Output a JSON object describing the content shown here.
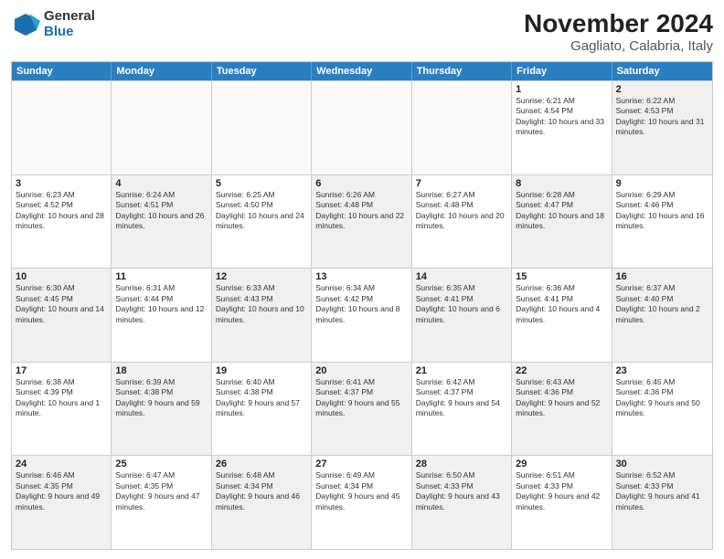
{
  "logo": {
    "general": "General",
    "blue": "Blue"
  },
  "title": "November 2024",
  "subtitle": "Gagliato, Calabria, Italy",
  "header_days": [
    "Sunday",
    "Monday",
    "Tuesday",
    "Wednesday",
    "Thursday",
    "Friday",
    "Saturday"
  ],
  "rows": [
    [
      {
        "day": "",
        "detail": "",
        "shaded": false,
        "empty": true
      },
      {
        "day": "",
        "detail": "",
        "shaded": false,
        "empty": true
      },
      {
        "day": "",
        "detail": "",
        "shaded": false,
        "empty": true
      },
      {
        "day": "",
        "detail": "",
        "shaded": false,
        "empty": true
      },
      {
        "day": "",
        "detail": "",
        "shaded": false,
        "empty": true
      },
      {
        "day": "1",
        "detail": "Sunrise: 6:21 AM\nSunset: 4:54 PM\nDaylight: 10 hours and 33 minutes.",
        "shaded": false,
        "empty": false
      },
      {
        "day": "2",
        "detail": "Sunrise: 6:22 AM\nSunset: 4:53 PM\nDaylight: 10 hours and 31 minutes.",
        "shaded": true,
        "empty": false
      }
    ],
    [
      {
        "day": "3",
        "detail": "Sunrise: 6:23 AM\nSunset: 4:52 PM\nDaylight: 10 hours and 28 minutes.",
        "shaded": false,
        "empty": false
      },
      {
        "day": "4",
        "detail": "Sunrise: 6:24 AM\nSunset: 4:51 PM\nDaylight: 10 hours and 26 minutes.",
        "shaded": true,
        "empty": false
      },
      {
        "day": "5",
        "detail": "Sunrise: 6:25 AM\nSunset: 4:50 PM\nDaylight: 10 hours and 24 minutes.",
        "shaded": false,
        "empty": false
      },
      {
        "day": "6",
        "detail": "Sunrise: 6:26 AM\nSunset: 4:48 PM\nDaylight: 10 hours and 22 minutes.",
        "shaded": true,
        "empty": false
      },
      {
        "day": "7",
        "detail": "Sunrise: 6:27 AM\nSunset: 4:48 PM\nDaylight: 10 hours and 20 minutes.",
        "shaded": false,
        "empty": false
      },
      {
        "day": "8",
        "detail": "Sunrise: 6:28 AM\nSunset: 4:47 PM\nDaylight: 10 hours and 18 minutes.",
        "shaded": true,
        "empty": false
      },
      {
        "day": "9",
        "detail": "Sunrise: 6:29 AM\nSunset: 4:46 PM\nDaylight: 10 hours and 16 minutes.",
        "shaded": false,
        "empty": false
      }
    ],
    [
      {
        "day": "10",
        "detail": "Sunrise: 6:30 AM\nSunset: 4:45 PM\nDaylight: 10 hours and 14 minutes.",
        "shaded": true,
        "empty": false
      },
      {
        "day": "11",
        "detail": "Sunrise: 6:31 AM\nSunset: 4:44 PM\nDaylight: 10 hours and 12 minutes.",
        "shaded": false,
        "empty": false
      },
      {
        "day": "12",
        "detail": "Sunrise: 6:33 AM\nSunset: 4:43 PM\nDaylight: 10 hours and 10 minutes.",
        "shaded": true,
        "empty": false
      },
      {
        "day": "13",
        "detail": "Sunrise: 6:34 AM\nSunset: 4:42 PM\nDaylight: 10 hours and 8 minutes.",
        "shaded": false,
        "empty": false
      },
      {
        "day": "14",
        "detail": "Sunrise: 6:35 AM\nSunset: 4:41 PM\nDaylight: 10 hours and 6 minutes.",
        "shaded": true,
        "empty": false
      },
      {
        "day": "15",
        "detail": "Sunrise: 6:36 AM\nSunset: 4:41 PM\nDaylight: 10 hours and 4 minutes.",
        "shaded": false,
        "empty": false
      },
      {
        "day": "16",
        "detail": "Sunrise: 6:37 AM\nSunset: 4:40 PM\nDaylight: 10 hours and 2 minutes.",
        "shaded": true,
        "empty": false
      }
    ],
    [
      {
        "day": "17",
        "detail": "Sunrise: 6:38 AM\nSunset: 4:39 PM\nDaylight: 10 hours and 1 minute.",
        "shaded": false,
        "empty": false
      },
      {
        "day": "18",
        "detail": "Sunrise: 6:39 AM\nSunset: 4:38 PM\nDaylight: 9 hours and 59 minutes.",
        "shaded": true,
        "empty": false
      },
      {
        "day": "19",
        "detail": "Sunrise: 6:40 AM\nSunset: 4:38 PM\nDaylight: 9 hours and 57 minutes.",
        "shaded": false,
        "empty": false
      },
      {
        "day": "20",
        "detail": "Sunrise: 6:41 AM\nSunset: 4:37 PM\nDaylight: 9 hours and 55 minutes.",
        "shaded": true,
        "empty": false
      },
      {
        "day": "21",
        "detail": "Sunrise: 6:42 AM\nSunset: 4:37 PM\nDaylight: 9 hours and 54 minutes.",
        "shaded": false,
        "empty": false
      },
      {
        "day": "22",
        "detail": "Sunrise: 6:43 AM\nSunset: 4:36 PM\nDaylight: 9 hours and 52 minutes.",
        "shaded": true,
        "empty": false
      },
      {
        "day": "23",
        "detail": "Sunrise: 6:45 AM\nSunset: 4:36 PM\nDaylight: 9 hours and 50 minutes.",
        "shaded": false,
        "empty": false
      }
    ],
    [
      {
        "day": "24",
        "detail": "Sunrise: 6:46 AM\nSunset: 4:35 PM\nDaylight: 9 hours and 49 minutes.",
        "shaded": true,
        "empty": false
      },
      {
        "day": "25",
        "detail": "Sunrise: 6:47 AM\nSunset: 4:35 PM\nDaylight: 9 hours and 47 minutes.",
        "shaded": false,
        "empty": false
      },
      {
        "day": "26",
        "detail": "Sunrise: 6:48 AM\nSunset: 4:34 PM\nDaylight: 9 hours and 46 minutes.",
        "shaded": true,
        "empty": false
      },
      {
        "day": "27",
        "detail": "Sunrise: 6:49 AM\nSunset: 4:34 PM\nDaylight: 9 hours and 45 minutes.",
        "shaded": false,
        "empty": false
      },
      {
        "day": "28",
        "detail": "Sunrise: 6:50 AM\nSunset: 4:33 PM\nDaylight: 9 hours and 43 minutes.",
        "shaded": true,
        "empty": false
      },
      {
        "day": "29",
        "detail": "Sunrise: 6:51 AM\nSunset: 4:33 PM\nDaylight: 9 hours and 42 minutes.",
        "shaded": false,
        "empty": false
      },
      {
        "day": "30",
        "detail": "Sunrise: 6:52 AM\nSunset: 4:33 PM\nDaylight: 9 hours and 41 minutes.",
        "shaded": true,
        "empty": false
      }
    ]
  ]
}
